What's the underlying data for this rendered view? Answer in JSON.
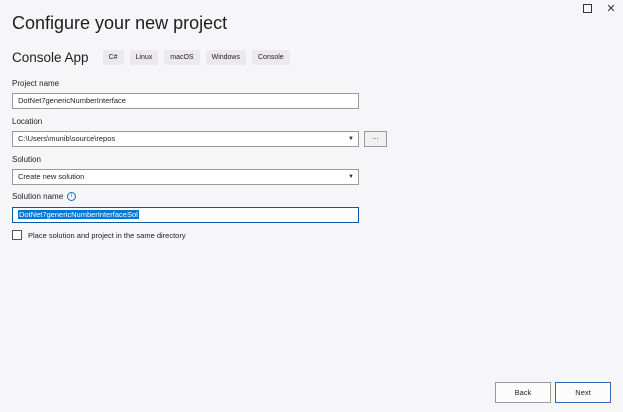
{
  "window": {
    "maximize_icon": "maximize-icon",
    "close_glyph": "✕"
  },
  "page": {
    "title": "Configure your new project"
  },
  "template": {
    "name": "Console App",
    "tags": [
      "C#",
      "Linux",
      "macOS",
      "Windows",
      "Console"
    ]
  },
  "project_name": {
    "label": "Project name",
    "value": "DotNet7genericNumberInterface"
  },
  "location": {
    "label": "Location",
    "value": "C:\\Users\\munib\\source\\repos",
    "browse_label": "..."
  },
  "solution": {
    "label": "Solution",
    "value": "Create new solution"
  },
  "solution_name": {
    "label": "Solution name",
    "info_glyph": "i",
    "value": "DotNet7genericNumberInterfaceSol"
  },
  "same_directory": {
    "label": "Place solution and project in the same directory",
    "checked": false
  },
  "footer": {
    "back_label": "Back",
    "next_label": "Next"
  },
  "colors": {
    "background": "#f6f5f8",
    "selection": "#0078d7",
    "accent": "#2b6cb4"
  }
}
